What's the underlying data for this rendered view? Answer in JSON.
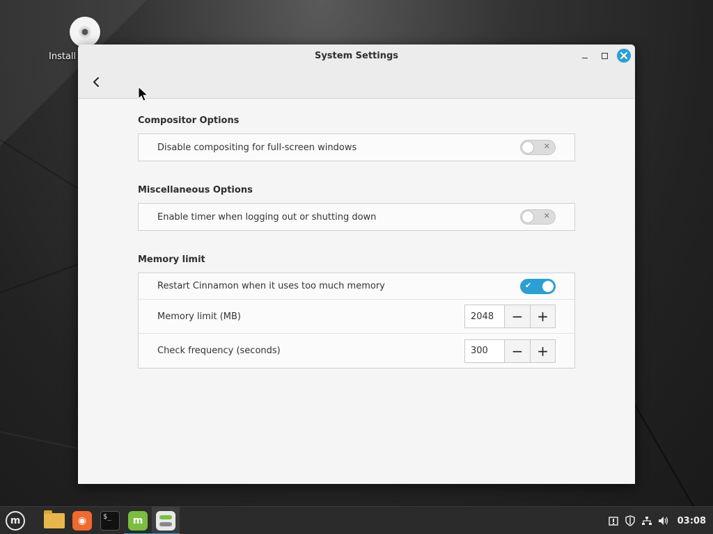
{
  "desktop": {
    "icons": [
      {
        "label": "Install"
      }
    ]
  },
  "window": {
    "title": "System Settings",
    "controls": {
      "minimize": "minimize-icon",
      "maximize": "maximize-icon",
      "close": "close-icon"
    }
  },
  "sections": [
    {
      "title": "Compositor Options",
      "rows": [
        {
          "label": "Disable compositing for full-screen windows",
          "control": "switch",
          "state": "off"
        }
      ]
    },
    {
      "title": "Miscellaneous Options",
      "rows": [
        {
          "label": "Enable timer when logging out or shutting down",
          "control": "switch",
          "state": "off"
        }
      ]
    },
    {
      "title": "Memory limit",
      "rows": [
        {
          "label": "Restart Cinnamon when it uses too much memory",
          "control": "switch",
          "state": "on"
        },
        {
          "label": "Memory limit (MB)",
          "control": "spin",
          "value": "2048",
          "minus": "−",
          "plus": "+"
        },
        {
          "label": "Check frequency (seconds)",
          "control": "spin",
          "value": "300",
          "minus": "−",
          "plus": "+"
        }
      ]
    }
  ],
  "taskbar": {
    "menu_icon": "linux-mint-menu-icon",
    "apps": [
      "files-icon",
      "firefox-icon",
      "terminal-icon",
      "mint-update-icon",
      "system-settings-icon"
    ],
    "tray": [
      "notifications-icon",
      "shield-icon",
      "network-icon",
      "volume-icon"
    ],
    "clock": "03:08"
  },
  "colors": {
    "accent": "#2a9fd6",
    "mint_green": "#7bbd3f"
  }
}
